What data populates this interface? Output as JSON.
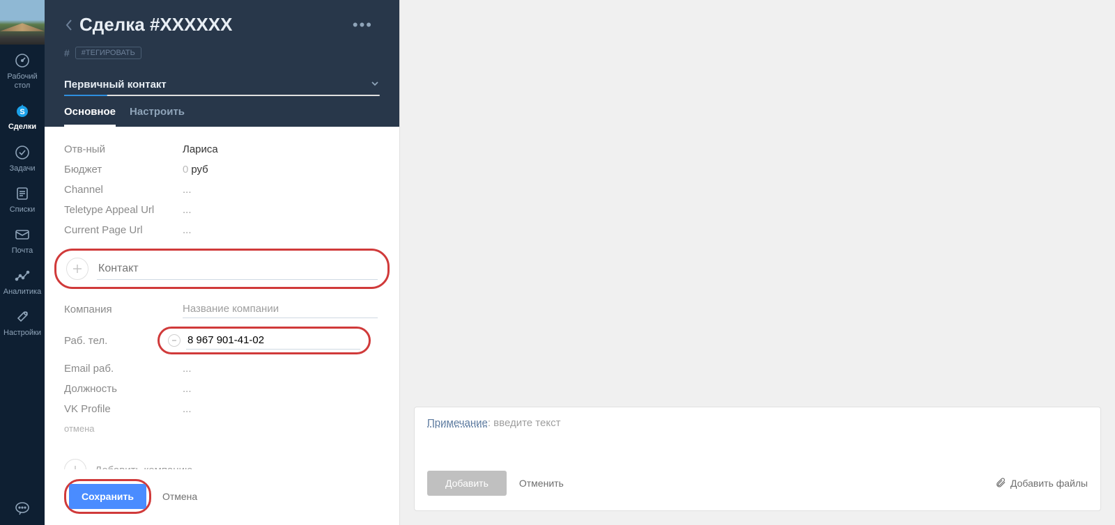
{
  "sidebar": {
    "items": [
      {
        "label": "Рабочий\nстол"
      },
      {
        "label": "Сделки"
      },
      {
        "label": "Задачи"
      },
      {
        "label": "Списки"
      },
      {
        "label": "Почта"
      },
      {
        "label": "Аналитика"
      },
      {
        "label": "Настройки"
      }
    ]
  },
  "header": {
    "title": "Сделка #XXXXXX",
    "tag_placeholder": "#ТЕГИРОВАТЬ",
    "contact_select": "Первичный контакт",
    "tabs": [
      {
        "label": "Основное"
      },
      {
        "label": "Настроить"
      }
    ]
  },
  "fields": {
    "responsible": {
      "label": "Отв-ный",
      "value": "Лариса"
    },
    "budget": {
      "label": "Бюджет",
      "value_num": "0",
      "currency": "руб"
    },
    "channel": {
      "label": "Channel",
      "value": "..."
    },
    "teletype": {
      "label": "Teletype Appeal Url",
      "value": "..."
    },
    "current_page": {
      "label": "Current Page Url",
      "value": "..."
    }
  },
  "contact": {
    "placeholder": "Контакт",
    "company": {
      "label": "Компания",
      "placeholder": "Название компании"
    },
    "work_phone": {
      "label": "Раб. тел.",
      "value": "8 967 901-41-02"
    },
    "work_email": {
      "label": "Email раб.",
      "value": "..."
    },
    "position": {
      "label": "Должность",
      "value": "..."
    },
    "vk": {
      "label": "VK Profile",
      "value": "..."
    },
    "cancel": "отмена"
  },
  "add_company": "Добавить компанию",
  "footer": {
    "save": "Сохранить",
    "cancel": "Отмена"
  },
  "note": {
    "label": "Примечание",
    "placeholder": "введите текст",
    "add": "Добавить",
    "cancel": "Отменить",
    "attach": "Добавить файлы"
  }
}
